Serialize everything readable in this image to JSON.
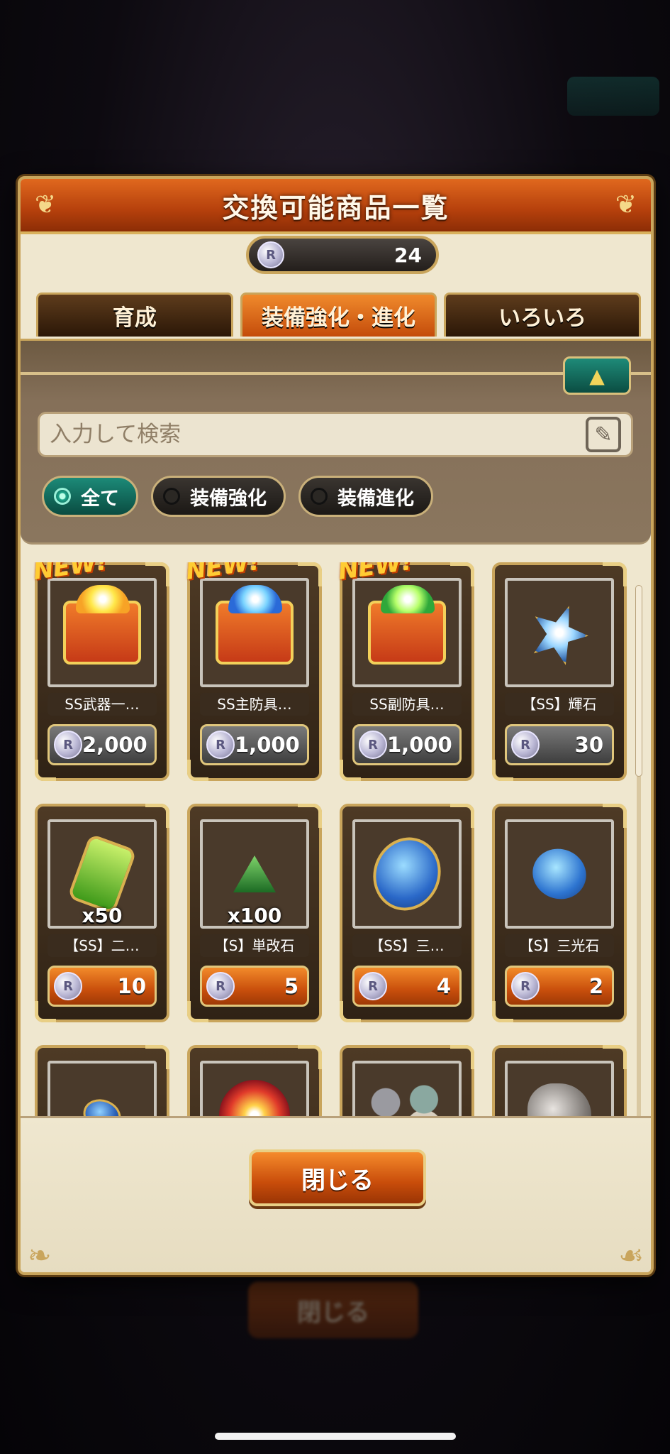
{
  "modal": {
    "title": "交換可能商品一覧",
    "currency_amount": "24",
    "tabs": [
      {
        "label": "育成",
        "active": false
      },
      {
        "label": "装備強化・進化",
        "active": true
      },
      {
        "label": "いろいろ",
        "active": false
      }
    ],
    "search": {
      "placeholder": "入力して検索",
      "value": ""
    },
    "filters": [
      {
        "label": "全て",
        "selected": true
      },
      {
        "label": "装備強化",
        "selected": false
      },
      {
        "label": "装備進化",
        "selected": false
      }
    ],
    "new_badge": "NEW!",
    "items": [
      {
        "name": "SS武器一…",
        "cost": "2,000",
        "qty": "",
        "is_new": true,
        "style": "gray",
        "art": "chest-gold"
      },
      {
        "name": "SS主防具…",
        "cost": "1,000",
        "qty": "",
        "is_new": true,
        "style": "gray",
        "art": "chest-blue"
      },
      {
        "name": "SS副防具…",
        "cost": "1,000",
        "qty": "",
        "is_new": true,
        "style": "gray",
        "art": "chest-green"
      },
      {
        "name": "【SS】輝石",
        "cost": "30",
        "qty": "",
        "is_new": false,
        "style": "gray",
        "art": "star-gem"
      },
      {
        "name": "【SS】二…",
        "cost": "10",
        "qty": "x50",
        "is_new": false,
        "style": "orange",
        "art": "green-gem"
      },
      {
        "name": "【S】単改石",
        "cost": "5",
        "qty": "x100",
        "is_new": false,
        "style": "orange",
        "art": "green-small-gem"
      },
      {
        "name": "【SS】三…",
        "cost": "4",
        "qty": "",
        "is_new": false,
        "style": "orange",
        "art": "blue-egg-gem"
      },
      {
        "name": "【S】三光石",
        "cost": "2",
        "qty": "",
        "is_new": false,
        "style": "orange",
        "art": "blue-round-gem"
      },
      {
        "name": "",
        "cost": "",
        "qty": "",
        "is_new": false,
        "style": "orange",
        "art": "blue-small-gem"
      },
      {
        "name": "",
        "cost": "",
        "qty": "",
        "is_new": false,
        "style": "orange",
        "art": "red-orb"
      },
      {
        "name": "",
        "cost": "",
        "qty": "",
        "is_new": false,
        "style": "orange",
        "art": "rocks"
      },
      {
        "name": "",
        "cost": "",
        "qty": "",
        "is_new": false,
        "style": "orange",
        "art": "ore"
      }
    ],
    "close_label": "閉じる"
  },
  "background": {
    "bottom_button_label": "閉じる"
  },
  "colors": {
    "header_orange": "#c44c0b",
    "panel_brown": "#857059",
    "teal_active": "#1c8a78",
    "gold_border": "#c9a55c"
  }
}
